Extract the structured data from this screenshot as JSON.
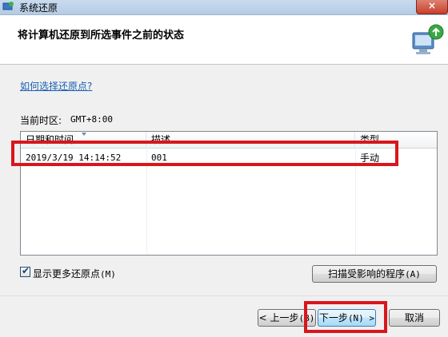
{
  "window": {
    "title": "系统还原",
    "close_glyph": "×"
  },
  "header": {
    "title": "将计算机还原到所选事件之前的状态",
    "icon": "computer-restore-icon"
  },
  "help_link": "如何选择还原点?",
  "timezone": {
    "label": "当前时区:",
    "value": "GMT+8:00"
  },
  "table": {
    "columns": [
      "日期和时间",
      "描述",
      "类型"
    ],
    "rows": [
      {
        "datetime": "2019/3/19 14:14:52",
        "description": "001",
        "type": "手动"
      }
    ]
  },
  "show_more": {
    "checked": true,
    "check_glyph": "✔",
    "label": "显示更多还原点",
    "accel": "(M)"
  },
  "buttons": {
    "scan": {
      "label": "扫描受影响的程序",
      "accel": "(A)"
    },
    "back": {
      "label": "< 上一步",
      "accel": "(B)"
    },
    "next": {
      "label": "下一步",
      "accel": "(N) >"
    },
    "cancel": {
      "label": "取消"
    }
  },
  "colors": {
    "highlight": "#d9161c",
    "link": "#1a5fb4"
  }
}
